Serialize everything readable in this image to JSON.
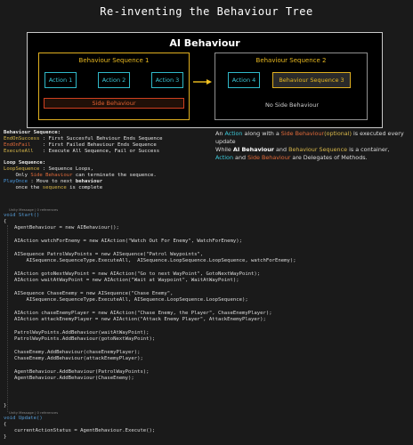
{
  "title": "Re-inventing the Behaviour Tree",
  "diagram": {
    "title": "AI Behaviour",
    "seq1": {
      "title": "Behaviour Sequence 1",
      "actions": [
        "Action 1",
        "Action 2",
        "Action 3"
      ],
      "side": "Side Behaviour"
    },
    "seq2": {
      "title": "Behaviour Sequence 2",
      "action": "Action 4",
      "nested": "Behaviour Sequence 3",
      "side": "No Side Behaviour"
    }
  },
  "legend": {
    "seq_header": "Behaviour Sequence:",
    "end_on_success_key": "EndOnSuccess",
    "end_on_success_text": " : First Succesful Behviour Ends Sequence",
    "end_on_fail_key": "EndOnFail",
    "end_on_fail_text": "    : First Failed Behaviour Ends Sequence",
    "execute_all_key": "ExecuteAll",
    "execute_all_text": "   : Execute All Sequence, Fail or Success",
    "loop_header": "Loop Sequence:",
    "loop_seq_key": "LoopSequence",
    "loop_seq_text": " : Sequence Loops,",
    "loop_seq_2a": "    Only ",
    "loop_seq_2b": "Side Behaviour",
    "loop_seq_2c": " can terminate the sequence.",
    "play_once_key": "PlayOnce",
    "play_once_text": " : Move to next ",
    "play_once_bold": "behaviour",
    "play_once_2a": "    once the ",
    "play_once_2b": "sequence",
    "play_once_2c": " is complete"
  },
  "note": {
    "l1a": "An ",
    "l1b": "Action",
    "l1c": " along with a ",
    "l1d": "Side Behaviour",
    "l1e": "(optional)",
    "l1f": " is executed every update",
    "l2a": "While ",
    "l2b": "AI Behaviour",
    "l2c": " and ",
    "l2d": "Behaviour Sequence",
    "l2e": " is a container,",
    "l3a": "Action",
    "l3b": " and ",
    "l3c": "Side Behaviour",
    "l3d": " are Delegates of Methods."
  },
  "code": {
    "meta1": "Unity Message | 0 references",
    "meta2": "Unity Message | 0 references",
    "start_decl": "void Start()",
    "lines": [
      "AgentBehaviour = new AIBehaviour();",
      "AIAction watchForEnemy = new AIAction(\"Watch Out For Enemy\", WatchForEnemy);",
      "AISequence PatrolWayPoints = new AISequence(\"Patrol Waypoints\",",
      "    AISequence.SequenceType.ExecuteAll,  AISequence.LoopSequence.LoopSequence, watchForEnemy);",
      "AIAction gotoNextWayPoint = new AIAction(\"Go to next WayPoint\", GotoNextWayPoint);",
      "AIAction waitAtWayPoint = new AIAction(\"Wait at Waypoint\", WaitAtWayPoint);",
      "AISequence ChaseEnemy = new AISequence(\"Chase Enemy\",",
      "    AISequence.SequenceType.ExecuteAll, AISequence.LoopSequence.LoopSequence);",
      "AIAction chaseEnemyPlayer = new AIAction(\"Chase Enemy, the Player\", ChaseEnemyPlayer);",
      "AIAction attackEnemyPlayer = new AIAction(\"Attack Enemy Player\", AttackEnemyPlayer);",
      "PatrolWayPoints.AddBehaviour(waitAtWayPoint);",
      "PatrolWayPoints.AddBehaviour(gotoNextWayPoint);",
      "ChaseEnemy.AddBehaviour(chaseEnemyPlayer);",
      "ChaseEnemy.AddBehaviour(attackEnemyPlayer);",
      "AgentBehaviour.AddBehaviour(PatrolWayPoints);",
      "AgentBehaviour.AddBehaviour(ChaseEnemy);"
    ],
    "update_decl": "void Update()",
    "update_line": "currentActionStatus = AgentBehaviour.Execute();",
    "open_brace": "{",
    "close_brace": "}"
  }
}
